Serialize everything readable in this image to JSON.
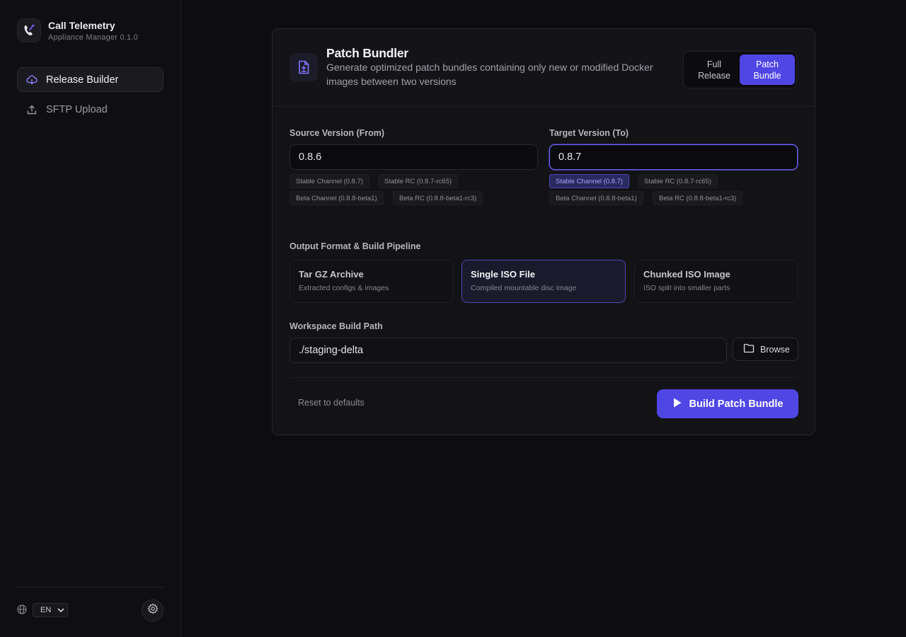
{
  "app": {
    "title": "Call Telemetry",
    "subtitle": "Appliance Manager 0.1.0",
    "logo_icon": "phone-icon"
  },
  "sidebar": {
    "items": [
      {
        "label": "Release Builder",
        "icon": "cloud-download-icon",
        "active": true
      },
      {
        "label": "SFTP Upload",
        "icon": "upload-icon",
        "active": false
      }
    ],
    "language": "EN"
  },
  "header": {
    "title": "Patch Bundler",
    "description": "Generate optimized patch bundles containing only new or modified Docker images between two versions",
    "modes": [
      {
        "label_line1": "Full",
        "label_line2": "Release",
        "selected": false
      },
      {
        "label_line1": "Patch",
        "label_line2": "Bundle",
        "selected": true
      }
    ]
  },
  "source": {
    "label": "Source Version (From)",
    "value": "0.8.6",
    "chips": [
      "Stable Channel (0.8.7)",
      "Stable RC (0.8.7-rc65)",
      "Beta Channel (0.8.8-beta1)",
      "Beta RC (0.8.8-beta1-rc3)"
    ]
  },
  "target": {
    "label": "Target Version (To)",
    "value": "0.8.7",
    "chips": [
      "Stable Channel (0.8.7)",
      "Stable RC (0.8.7-rc65)",
      "Beta Channel (0.8.8-beta1)",
      "Beta RC (0.8.8-beta1-rc3)"
    ],
    "active_chip": 0
  },
  "output": {
    "label": "Output Format & Build Pipeline",
    "options": [
      {
        "title": "Tar GZ Archive",
        "subtitle": "Extracted configs & images",
        "selected": false
      },
      {
        "title": "Single ISO File",
        "subtitle": "Compiled mountable disc image",
        "selected": true
      },
      {
        "title": "Chunked ISO Image",
        "subtitle": "ISO split into smaller parts",
        "selected": false
      }
    ]
  },
  "workspace": {
    "label": "Workspace Build Path",
    "value": "./staging-delta",
    "browse_label": "Browse"
  },
  "actions": {
    "reset_label": "Reset to defaults",
    "build_label": "Build Patch Bundle"
  },
  "colors": {
    "accent": "#5046e4",
    "background": "#0d0d10"
  }
}
